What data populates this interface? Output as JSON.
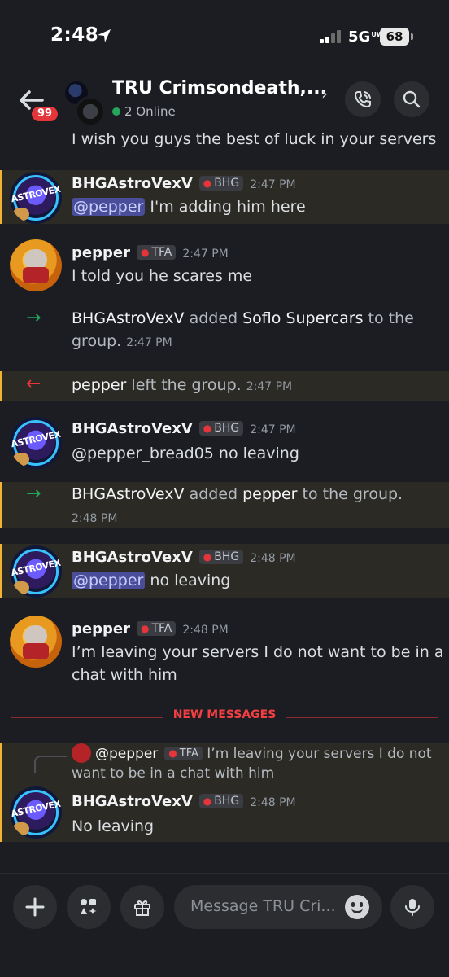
{
  "status_bar": {
    "time": "2:48",
    "network": "5G",
    "network_suffix": "UW",
    "battery": "68"
  },
  "header": {
    "back_badge": "99",
    "title": "TRU Crimsondeath,...",
    "online": "2 Online"
  },
  "messages": [
    {
      "type": "continuation",
      "text": "I wish you guys the best of luck in your servers"
    },
    {
      "type": "message",
      "author": "BHGAstroVexV",
      "tag": "BHG",
      "time": "2:47 PM",
      "mention": "@pepper",
      "text": " I'm adding him here",
      "highlight": true
    },
    {
      "type": "message",
      "author": "pepper",
      "tag": "TFA",
      "time": "2:47 PM",
      "text": "I told you he scares me"
    },
    {
      "type": "system_add",
      "actor": "BHGAstroVexV",
      "verb": " added ",
      "target": "Soflo Supercars",
      "tail": " to the",
      "line2": "group.",
      "time": "2:47 PM"
    },
    {
      "type": "system_leave",
      "actor": "pepper",
      "verb": " left the group.",
      "time": "2:47 PM"
    },
    {
      "type": "message",
      "author": "BHGAstroVexV",
      "tag": "BHG",
      "time": "2:47 PM",
      "text": "@pepper_bread05 no leaving"
    },
    {
      "type": "system_add",
      "actor": "BHGAstroVexV",
      "verb": " added ",
      "target": "pepper",
      "tail": " to the group.",
      "time": "2:48 PM"
    },
    {
      "type": "message",
      "author": "BHGAstroVexV",
      "tag": "BHG",
      "time": "2:48 PM",
      "mention": "@pepper",
      "text": " no leaving",
      "highlight": true
    },
    {
      "type": "message",
      "author": "pepper",
      "tag": "TFA",
      "time": "2:48 PM",
      "text": "I’m leaving your servers I do not want to be in a",
      "text2": "chat with him"
    }
  ],
  "divider": "NEW MESSAGES",
  "reply": {
    "author": "@pepper",
    "tag": "TFA",
    "text": "I’m leaving your servers I do not",
    "text2": "want to be in a chat with him",
    "message_author": "BHGAstroVexV",
    "message_tag": "BHG",
    "message_time": "2:48 PM",
    "message_text": "No leaving"
  },
  "composer": {
    "placeholder": "Message TRU Cri..."
  },
  "colors": {
    "background": "#1c1d22",
    "mention_highlight": "#2b2a25",
    "mention_border": "#f0b232",
    "new_messages": "#f23f42",
    "online": "#23a55a",
    "join_arrow": "#23a55a",
    "leave_arrow": "#e3353a"
  }
}
